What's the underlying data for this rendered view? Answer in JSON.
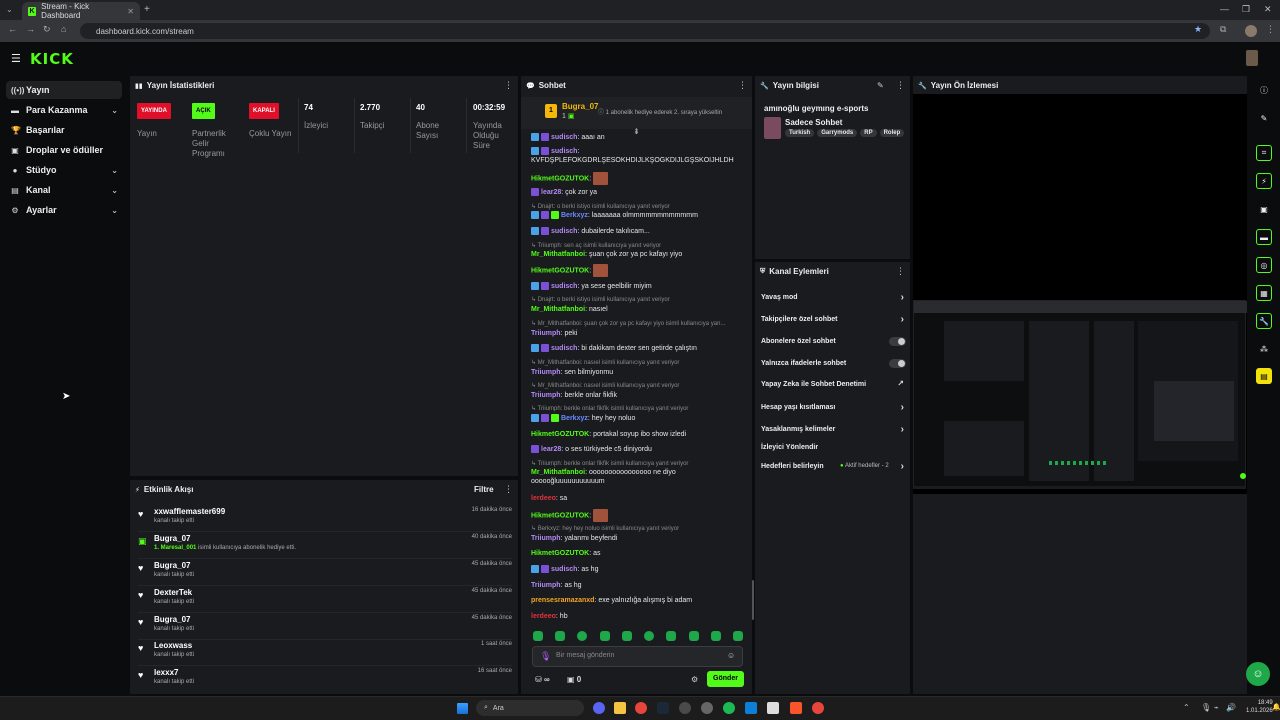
{
  "browser": {
    "tab_title": "Stream - Kick Dashboard",
    "url": "dashboard.kick.com/stream"
  },
  "header": {
    "logo": "KICK"
  },
  "sidebar": {
    "items": [
      {
        "label": "Yayın"
      },
      {
        "label": "Para Kazanma"
      },
      {
        "label": "Başarılar"
      },
      {
        "label": "Droplar ve ödüller"
      },
      {
        "label": "Stüdyo"
      },
      {
        "label": "Kanal"
      },
      {
        "label": "Ayarlar"
      }
    ]
  },
  "stats": {
    "title": "Yayın İstatistikleri",
    "items": [
      {
        "badge": "YAYINDA",
        "label": "Yayın",
        "color": "#e0102a"
      },
      {
        "badge": "AÇIK",
        "label": "Partnerlik Gelir Programı",
        "color": "#53fc18"
      },
      {
        "badge": "KAPALI",
        "label": "Çoklu Yayın",
        "color": "#e0102a"
      },
      {
        "value": "74",
        "label": "İzleyici"
      },
      {
        "value": "2.770",
        "label": "Takipçi"
      },
      {
        "value": "40",
        "label": "Abone Sayısı"
      },
      {
        "value": "00:32:59",
        "label": "Yayında Olduğu Süre"
      }
    ]
  },
  "events": {
    "title": "Etkinlik Akışı",
    "filter": "Filtre",
    "items": [
      {
        "name": "xxwafflemaster699",
        "sub": "kanalı takip etti",
        "time": "16 dakika önce"
      },
      {
        "name": "Bugra_07",
        "sub_user": "1. Maresal_001",
        "sub": "isimli kullanıcıya abonelik hediye etti.",
        "time": "40 dakika önce"
      },
      {
        "name": "Bugra_07",
        "sub": "kanalı takip etti",
        "time": "45 dakika önce"
      },
      {
        "name": "DexterTek",
        "sub": "kanalı takip etti",
        "time": "45 dakika önce"
      },
      {
        "name": "Bugra_07",
        "sub": "kanalı takip etti",
        "time": "45 dakika önce"
      },
      {
        "name": "Leoxwass",
        "sub": "kanalı takip etti",
        "time": "1 saat önce"
      },
      {
        "name": "lexxx7",
        "sub": "kanalı takip etti",
        "time": "16 saat önce"
      }
    ]
  },
  "chat": {
    "title": "Sohbet",
    "pinned_user": "Bugra_07",
    "pinned_count": "1",
    "pinned_text": "1 abonelik hediye ederek 2. sıraya yükseltin",
    "messages": [
      {
        "user": "sudisch",
        "text": "aaaı an",
        "color": "#b48af5"
      },
      {
        "user": "sudisch",
        "text": "KVFDŞPLEFOKGDRLŞESOKHDIJLKŞOGKDIJLGŞSKOIJHLDH",
        "color": "#b48af5"
      },
      {
        "user": "HikmetGOZUTOK",
        "text": "",
        "color": "#53fc18"
      },
      {
        "user": "lear28",
        "text": "çok zor ya",
        "color": "#b48af5"
      },
      {
        "reply": "Dnajrt: o berki istiyo isimli kullanıcıya yanıt veriyor"
      },
      {
        "user": "Berkxyz",
        "text": "laaaaaaa olmmmmmmmmmmmm",
        "color": "#6a8cff"
      },
      {
        "user": "sudisch",
        "text": "dubailerde takılıcam...",
        "color": "#b48af5"
      },
      {
        "reply": "Triiumph: sen aç isimli kullanıcıya yanıt veriyor"
      },
      {
        "user": "Mr_Mithatfanboi",
        "text": "şuan çok zor ya pc kafayı yiyo",
        "color": "#53fc18"
      },
      {
        "user": "HikmetGOZUTOK",
        "text": "",
        "color": "#53fc18"
      },
      {
        "user": "sudisch",
        "text": "ya sese geelbilir miyim",
        "color": "#b48af5"
      },
      {
        "reply": "Dnajrt: o berki istiyo isimli kullanıcıya yanıt veriyor"
      },
      {
        "user": "Mr_Mithatfanboi",
        "text": "nasıel",
        "color": "#53fc18"
      },
      {
        "reply": "Mr_Mithatfanboi: şuan çok zor ya pc kafayı yiyo isimli kullanıcıya yan..."
      },
      {
        "user": "Triiumph",
        "text": "peki",
        "color": "#b48af5"
      },
      {
        "user": "sudisch",
        "text": "bi dakikam dexter sen getirde çalıştın",
        "color": "#b48af5"
      },
      {
        "reply": "Mr_Mithatfanboi: nasıel isimli kullanıcıya yanıt veriyor"
      },
      {
        "user": "Triiumph",
        "text": "sen bilmiyonmu",
        "color": "#b48af5"
      },
      {
        "reply": "Mr_Mithatfanboi: nasıel isimli kullanıcıya yanıt veriyor"
      },
      {
        "user": "Triiumph",
        "text": "berkle onlar fikfik",
        "color": "#b48af5"
      },
      {
        "reply": "Triiumph: berkle onlar fikfik isimli kullanıcıya yanıt veriyor"
      },
      {
        "user": "Berkxyz",
        "text": "hey hey noluo",
        "color": "#6a8cff"
      },
      {
        "user": "HikmetGOZUTOK",
        "text": "portakal soyup ibo show izledi",
        "color": "#53fc18"
      },
      {
        "user": "lear28",
        "text": "o ses türkiyede c5 diniyordu",
        "color": "#b48af5"
      },
      {
        "reply": "Triiumph: berkle onlar fikfik isimli kullanıcıya yanıt veriyor"
      },
      {
        "user": "Mr_Mithatfanboi",
        "text": "oooooooooooooooo ne diyo oooooğluuuuuuuuuuum",
        "color": "#53fc18"
      },
      {
        "user": "lerdeeo",
        "text": "sa",
        "color": "#e0333a"
      },
      {
        "user": "HikmetGOZUTOK",
        "text": "",
        "color": "#53fc18"
      },
      {
        "reply": "Berkxyz: hey hey noluo isimli kullanıcıya yanıt veriyor"
      },
      {
        "user": "Triiumph",
        "text": "yalanmı beyfendi",
        "color": "#b48af5"
      },
      {
        "user": "HikmetGOZUTOK",
        "text": "as",
        "color": "#53fc18"
      },
      {
        "user": "sudisch",
        "text": "as hg",
        "color": "#b48af5"
      },
      {
        "user": "Triiumph",
        "text": "as hg",
        "color": "#b48af5"
      },
      {
        "user": "prensesramazanxd",
        "text": "exe yalnızlığa alışmış bi adam",
        "color": "#f5a623"
      },
      {
        "user": "lerdeeo",
        "text": "hb",
        "color": "#e0333a"
      }
    ],
    "input_placeholder": "Bir mesaj gönderin",
    "points": "∞",
    "gifts": "0",
    "send_label": "Gönder"
  },
  "stream_info": {
    "title": "Yayın bilgisi",
    "stream_title": "amınoğlu geymıng e-sports",
    "category": "Sadece Sohbet",
    "tags": [
      "Turkish",
      "Garrymods",
      "RP",
      "Rolep"
    ]
  },
  "channel_actions": {
    "title": "Kanal Eylemleri",
    "items": [
      {
        "label": "Yavaş mod",
        "kind": "arrow"
      },
      {
        "label": "Takipçilere özel sohbet",
        "kind": "arrow"
      },
      {
        "label": "Abonelere özel sohbet",
        "kind": "toggle"
      },
      {
        "label": "Yalnızca ifadelerle sohbet",
        "kind": "toggle"
      },
      {
        "label": "Yapay Zeka ile Sohbet Denetimi",
        "kind": "external"
      },
      {
        "label": "Hesap yaşı kısıtlaması",
        "kind": "arrow"
      },
      {
        "label": "Yasaklanmış kelimeler",
        "kind": "arrow"
      },
      {
        "label": "İzleyici Yönlendir",
        "kind": "none"
      },
      {
        "label": "Hedefleri belirleyin",
        "kind": "arrow",
        "extra": "Aktif hedefler - 2"
      }
    ]
  },
  "preview": {
    "title": "Yayın Ön İzlemesi"
  },
  "taskbar": {
    "search": "Ara",
    "time": "18:49",
    "date": "1.01.2026"
  },
  "colors": {
    "accent": "#53fc18",
    "panel": "#191b1f",
    "bg": "#0b0c0d",
    "live": "#e0102a"
  }
}
